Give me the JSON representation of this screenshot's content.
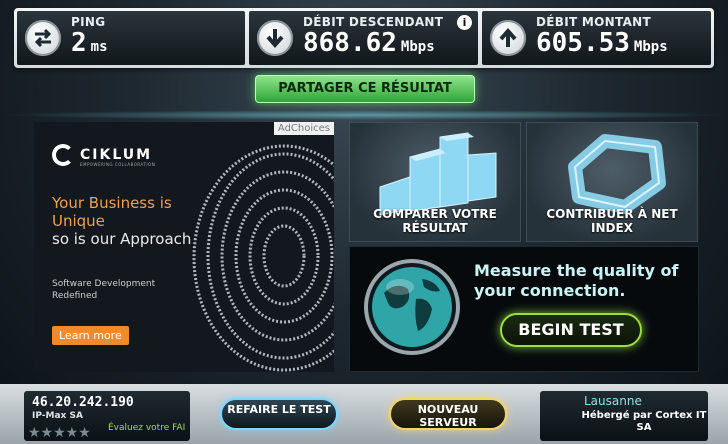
{
  "stats": {
    "ping": {
      "label": "PING",
      "value": "2",
      "unit": "ms",
      "icon": "ping-arrows-icon"
    },
    "download": {
      "label": "DÉBIT DESCENDANT",
      "value": "868.62",
      "unit": "Mbps",
      "icon": "download-arrow-icon"
    },
    "upload": {
      "label": "DÉBIT MONTANT",
      "value": "605.53",
      "unit": "Mbps",
      "icon": "upload-arrow-icon"
    },
    "info_glyph": "i"
  },
  "share_button": "PARTAGER CE RÉSULTAT",
  "ad": {
    "adchoices": "AdChoices",
    "logo": "CIKLUM",
    "tagline": "EMPOWERING COLLABORATION",
    "headline_orange": "Your Business is Unique",
    "headline_white": "so is our Approach",
    "subtext": "Software Development Redefined",
    "button": "Learn more"
  },
  "tiles": {
    "compare": "COMPARER VOTRE RÉSULTAT",
    "contribute": "CONTRIBUER À NET INDEX"
  },
  "begin_panel": {
    "title": "Measure the quality of your connection.",
    "button": "BEGIN TEST"
  },
  "bottom": {
    "ip": "46.20.242.190",
    "isp": "IP-Max SA",
    "rating_prompt": "Évaluez votre FAI",
    "stars": "★★★★★",
    "retest": "REFAIRE LE TEST",
    "new_server": "NOUVEAU SERVEUR",
    "city": "Lausanne",
    "hosted_by": "Hébergé par Cortex IT SA"
  },
  "colors": {
    "accent_green": "#2fa535",
    "accent_blue": "#7fd6ff",
    "accent_gold": "#f3d36a",
    "ad_orange": "#ef8a2d"
  }
}
